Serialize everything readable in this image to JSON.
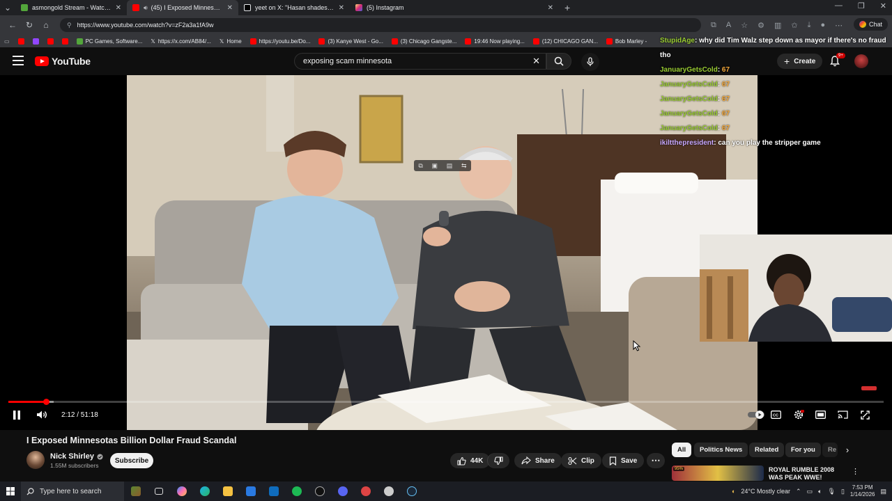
{
  "browser": {
    "tabs": [
      {
        "title": "asmongold Stream - Watch Live o",
        "favicon_color": "#53a63b",
        "active": false
      },
      {
        "title": "(45) I Exposed Minnesotas B",
        "favicon_color": "#ff0000",
        "active": true
      },
      {
        "title": "yeet on X: \"Hasan shades Adin Ro",
        "favicon_color": "#e8eaed",
        "active": false
      },
      {
        "title": "(5) Instagram",
        "favicon_color": "#d6249f",
        "active": false
      }
    ],
    "new_tab_glyph": "+",
    "url": "https://www.youtube.com/watch?v=zF2a3a1fA9w",
    "chat_label": "Chat",
    "bookmarks": [
      {
        "label": "",
        "color": "#ff0000"
      },
      {
        "label": "",
        "color": "#9146ff"
      },
      {
        "label": "",
        "color": "#ff0000"
      },
      {
        "label": "",
        "color": "#ff0000"
      },
      {
        "label": "PC Games, Software...",
        "color": "#53a63b"
      },
      {
        "label": "https://x.com/AB84/...",
        "color": "#e8eaed"
      },
      {
        "label": "Home",
        "color": "#e8eaed"
      },
      {
        "label": "https://youtu.be/Do...",
        "color": "#ff0000"
      },
      {
        "label": "(3) Kanye West - Go...",
        "color": "#ff0000"
      },
      {
        "label": "(3) Chicago Gangste...",
        "color": "#ff0000"
      },
      {
        "label": "19:46 Now playing...",
        "color": "#ff0000"
      },
      {
        "label": "(12) CHICAGO GAN...",
        "color": "#ff0000"
      },
      {
        "label": "Bob Marley -",
        "color": "#ff0000"
      }
    ]
  },
  "youtube": {
    "logo_text": "YouTube",
    "search_value": "exposing scam minnesota",
    "create_label": "Create",
    "notif_badge": "9+"
  },
  "stream_chat": [
    {
      "user": "StupidAge",
      "message": "why did Tim Walz step down as mayor if there's no fraud tho",
      "emote": "",
      "purple": false
    },
    {
      "user": "JanuaryGetsCold",
      "message": "",
      "emote": "67",
      "purple": false
    },
    {
      "user": "JanuaryGetsCold",
      "message": "",
      "emote": "67",
      "purple": false
    },
    {
      "user": "JanuaryGetsCold",
      "message": "",
      "emote": "67",
      "purple": false
    },
    {
      "user": "JanuaryGetsCold",
      "message": "",
      "emote": "67",
      "purple": false
    },
    {
      "user": "JanuaryGetsCold",
      "message": "",
      "emote": "67",
      "purple": false
    },
    {
      "user": "ikiltthepresident",
      "message": "can you play the stripper game",
      "emote": "",
      "purple": true
    }
  ],
  "player": {
    "current_time": "2:12",
    "duration": "51:18",
    "time_display": "2:12 / 51:18",
    "played_fraction": 0.043,
    "buffered_fraction": 0.052
  },
  "video": {
    "title": "I Exposed Minnesotas Billion Dollar Fraud Scandal",
    "channel": "Nick Shirley",
    "subscribers": "1.55M subscribers",
    "subscribe_label": "Subscribe",
    "likes": "44K",
    "share_label": "Share",
    "clip_label": "Clip",
    "save_label": "Save"
  },
  "chips": [
    "All",
    "Politics News",
    "Related",
    "For you",
    "Re"
  ],
  "recommended": {
    "title": "ROYAL RUMBLE 2008 WAS PEAK WWE!",
    "rating": "95%"
  },
  "taskbar": {
    "search_placeholder": "Type here to search",
    "weather": "24°C  Mostly clear",
    "time": "7:53 PM",
    "date": "1/14/2026"
  }
}
